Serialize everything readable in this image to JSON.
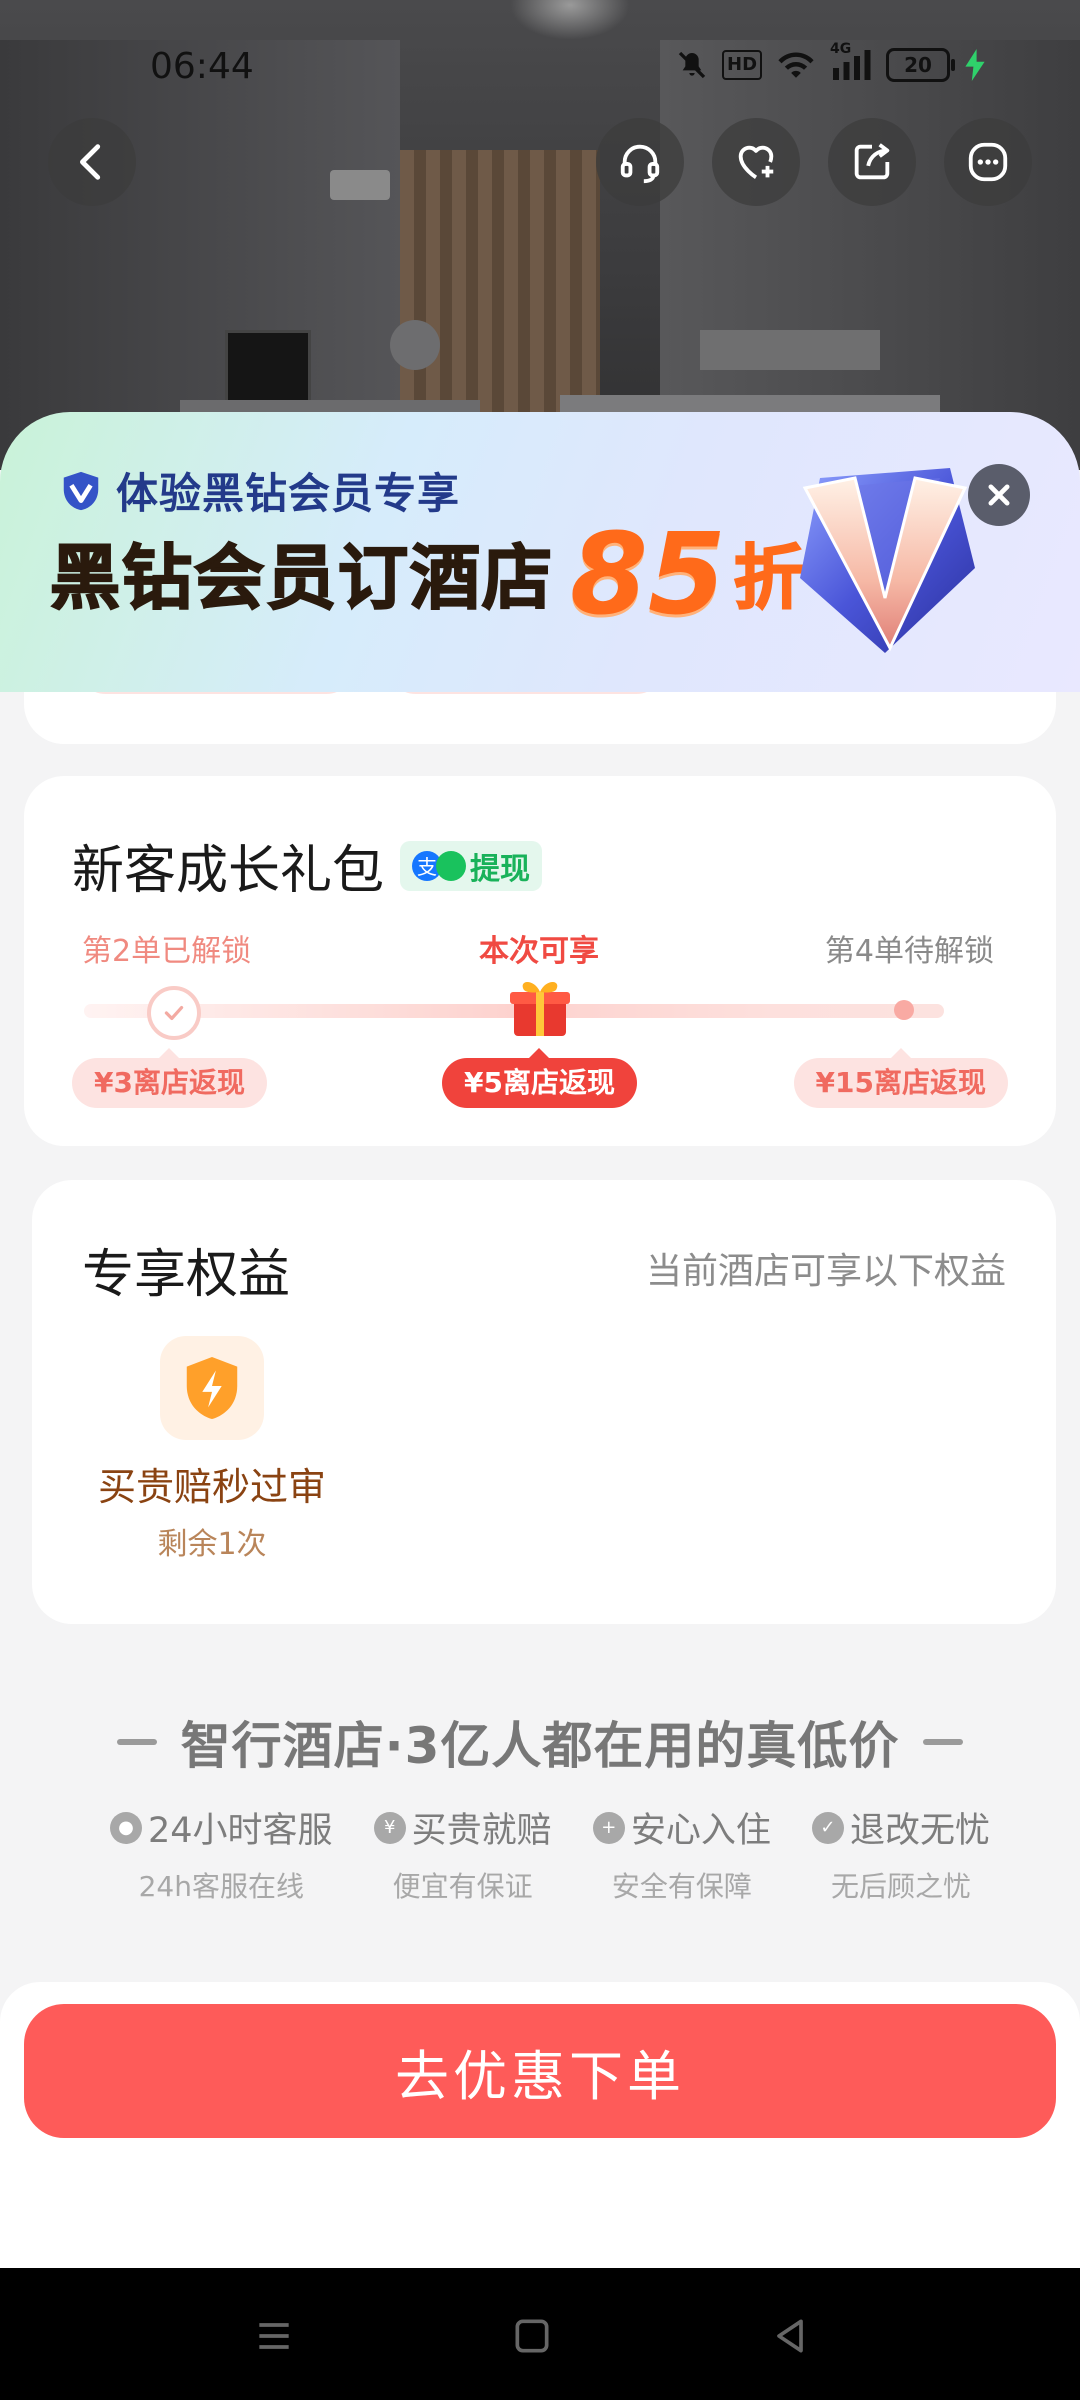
{
  "status_bar": {
    "time": "06:44",
    "hd_label": "HD",
    "network_label": "4G",
    "battery": "20"
  },
  "nav": {
    "icons": [
      "back-icon",
      "headset-icon",
      "favorite-add-icon",
      "share-icon",
      "more-icon"
    ]
  },
  "banner": {
    "subtitle": "体验黑钻会员专享",
    "title": "黑钻会员订酒店",
    "discount": "85",
    "discount_suffix": "折"
  },
  "gift_pack": {
    "title": "新客成长礼包",
    "withdraw_label": "提现",
    "steps": [
      {
        "label": "第2单已解锁",
        "reward": "¥3离店返现",
        "state": "done"
      },
      {
        "label": "本次可享",
        "reward": "¥5离店返现",
        "state": "current"
      },
      {
        "label": "第4单待解锁",
        "reward": "¥15离店返现",
        "state": "locked"
      }
    ]
  },
  "benefits": {
    "title": "专享权益",
    "note": "当前酒店可享以下权益",
    "items": [
      {
        "name": "买贵赔秒过审",
        "remain": "剩余1次"
      }
    ]
  },
  "slogan": "智行酒店·3亿人都在用的真低价",
  "assurances": [
    {
      "title": "24小时客服",
      "sub": "24h客服在线"
    },
    {
      "title": "买贵就赔",
      "sub": "便宜有保证"
    },
    {
      "title": "安心入住",
      "sub": "安全有保障"
    },
    {
      "title": "退改无忧",
      "sub": "无后顾之忧"
    }
  ],
  "cta": {
    "label": "去优惠下单"
  },
  "colors": {
    "accent": "#fe5b59",
    "reward_red": "#f0433c",
    "withdraw_green": "#19b25a",
    "benefit_brown": "#8a4312"
  }
}
